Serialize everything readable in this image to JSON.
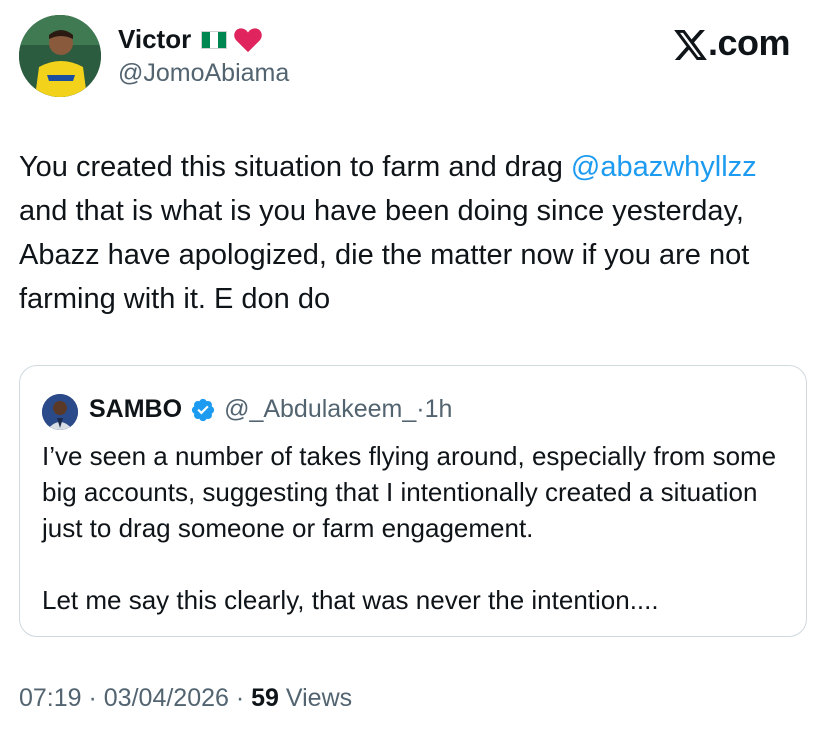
{
  "author": {
    "name": "Victor",
    "handle": "@JomoAbiama",
    "flag_icon": "nigeria-flag-icon",
    "heart_icon": "red-heart-icon"
  },
  "brand": {
    "logo_text": ".com"
  },
  "tweet": {
    "text_before": "You created this situation to farm and drag ",
    "mention": "@abazwhyllzz",
    "text_after": " and that is what is you have been doing since yesterday, Abazz have apologized, die the matter now if you are not farming with it. E don do"
  },
  "quote": {
    "name": "SAMBO",
    "handle": "@_Abdulakeem_",
    "separator": " · ",
    "time": "1h",
    "text": "I’ve seen a number of takes flying around, especially from some big accounts, suggesting that I intentionally created a situation just to drag someone or farm engagement.\n\nLet me say this clearly, that was never the intention...."
  },
  "meta": {
    "time": "07:19",
    "date": "03/04/2026",
    "separator": " · ",
    "views_count": "59",
    "views_label": " Views"
  },
  "colors": {
    "link": "#1d9bf0",
    "secondary": "#536471",
    "border": "#cfd9de",
    "verified": "#1d9bf0",
    "heart": "#e0245e"
  }
}
